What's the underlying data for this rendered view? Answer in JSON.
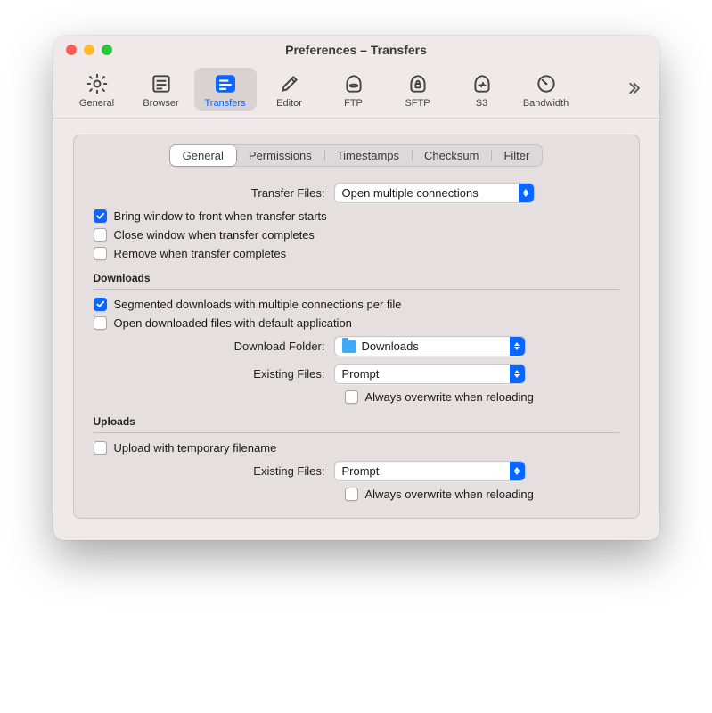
{
  "window": {
    "title": "Preferences – Transfers"
  },
  "toolbar": {
    "items": [
      {
        "id": "general",
        "label": "General"
      },
      {
        "id": "browser",
        "label": "Browser"
      },
      {
        "id": "transfers",
        "label": "Transfers"
      },
      {
        "id": "editor",
        "label": "Editor"
      },
      {
        "id": "ftp",
        "label": "FTP"
      },
      {
        "id": "sftp",
        "label": "SFTP"
      },
      {
        "id": "s3",
        "label": "S3"
      },
      {
        "id": "bandwidth",
        "label": "Bandwidth"
      }
    ],
    "selected": "transfers"
  },
  "tabs": {
    "general": "General",
    "permissions": "Permissions",
    "timestamps": "Timestamps",
    "checksum": "Checksum",
    "filter": "Filter",
    "active": "general"
  },
  "transfer": {
    "files_label": "Transfer Files:",
    "files_value": "Open multiple connections",
    "bring_to_front": {
      "checked": true,
      "label": "Bring window to front when transfer starts"
    },
    "close_on_done": {
      "checked": false,
      "label": "Close window when transfer completes"
    },
    "remove_on_done": {
      "checked": false,
      "label": "Remove when transfer completes"
    }
  },
  "downloads": {
    "heading": "Downloads",
    "segmented": {
      "checked": true,
      "label": "Segmented downloads with multiple connections per file"
    },
    "open_def": {
      "checked": false,
      "label": "Open downloaded files with default application"
    },
    "folder_label": "Download Folder:",
    "folder_value": "Downloads",
    "existing_label": "Existing Files:",
    "existing_value": "Prompt",
    "always_overwrite": {
      "checked": false,
      "label": "Always overwrite when reloading"
    }
  },
  "uploads": {
    "heading": "Uploads",
    "temp_name": {
      "checked": false,
      "label": "Upload with temporary filename"
    },
    "existing_label": "Existing Files:",
    "existing_value": "Prompt",
    "always_overwrite": {
      "checked": false,
      "label": "Always overwrite when reloading"
    }
  }
}
